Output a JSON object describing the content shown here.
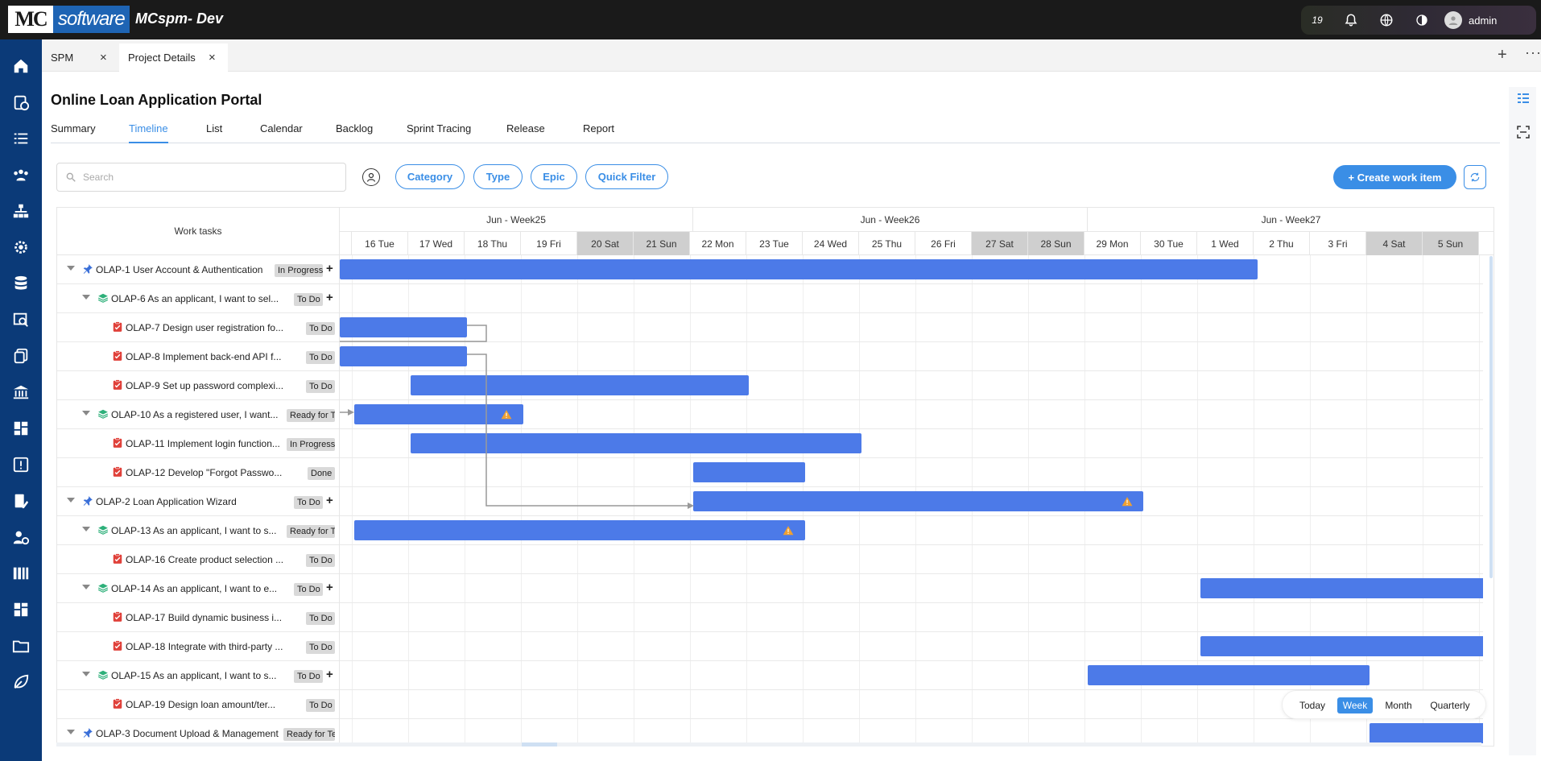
{
  "app": {
    "logo_mark": "MC",
    "logo_text": "software",
    "title": "MCspm- Dev",
    "notification_count": "19",
    "username": "admin"
  },
  "colors": {
    "accent": "#3a8ee6",
    "bar": "#4c7ae8",
    "sidebar": "#0b3a78",
    "topbar": "#1a1a1a"
  },
  "sidebar_icons": [
    "home-icon",
    "clipboard-clock-icon",
    "list-icon",
    "team-icon",
    "hierarchy-icon",
    "settings-icon",
    "database-icon",
    "search-doc-icon",
    "copy-icon",
    "bank-icon",
    "dashboard-icon",
    "alert-icon",
    "report-edit-icon",
    "user-clock-icon",
    "library-icon",
    "grid-icon",
    "folder-icon",
    "leaf-icon"
  ],
  "tabs": [
    {
      "label": "SPM"
    },
    {
      "label": "Project Details"
    }
  ],
  "project": {
    "title": "Online Loan Application Portal"
  },
  "nav_tabs": [
    "Summary",
    "Timeline",
    "List",
    "Calendar",
    "Backlog",
    "Sprint Tracing",
    "Release",
    "Report"
  ],
  "nav_active": "Timeline",
  "toolbar": {
    "search_placeholder": "Search",
    "filters": [
      "Category",
      "Type",
      "Epic",
      "Quick Filter"
    ],
    "create_label": "+ Create work item"
  },
  "gantt": {
    "left_header": "Work tasks",
    "weeks": [
      "Jun - Week25",
      "Jun - Week26",
      "Jun - Week27"
    ],
    "days": [
      "16 Tue",
      "17 Wed",
      "18 Thu",
      "19 Fri",
      "20 Sat",
      "21 Sun",
      "22 Mon",
      "23 Tue",
      "24 Wed",
      "25 Thu",
      "26 Fri",
      "27 Sat",
      "28 Sun",
      "29 Mon",
      "30 Tue",
      "1 Wed",
      "2 Thu",
      "3 Fri",
      "4 Sat",
      "5 Sun"
    ],
    "rows": [
      {
        "text": "OLAP-1 User Account & Authentication",
        "status": "In Progress",
        "type": "epic",
        "add": true
      },
      {
        "text": "OLAP-6 As an applicant, I want to sel...",
        "status": "To Do",
        "type": "story",
        "add": true
      },
      {
        "text": "OLAP-7 Design user registration fo...",
        "status": "To Do",
        "type": "task"
      },
      {
        "text": "OLAP-8 Implement back-end API f...",
        "status": "To Do",
        "type": "task"
      },
      {
        "text": "OLAP-9 Set up password complexi...",
        "status": "To Do",
        "type": "task"
      },
      {
        "text": "OLAP-10 As a registered user, I want...",
        "status": "Ready for T",
        "type": "story"
      },
      {
        "text": "OLAP-11 Implement login function...",
        "status": "In Progress",
        "type": "task"
      },
      {
        "text": "OLAP-12 Develop \"Forgot Passwo...",
        "status": "Done",
        "type": "task"
      },
      {
        "text": "OLAP-2 Loan Application Wizard",
        "status": "To Do",
        "type": "epic",
        "add": true
      },
      {
        "text": "OLAP-13 As an applicant, I want to s...",
        "status": "Ready for T",
        "type": "story"
      },
      {
        "text": "OLAP-16 Create product selection ...",
        "status": "To Do",
        "type": "task"
      },
      {
        "text": "OLAP-14 As an applicant, I want to e...",
        "status": "To Do",
        "type": "story",
        "add": true
      },
      {
        "text": "OLAP-17 Build dynamic business i...",
        "status": "To Do",
        "type": "task"
      },
      {
        "text": "OLAP-18 Integrate with third-party ...",
        "status": "To Do",
        "type": "task"
      },
      {
        "text": "OLAP-15 As an applicant, I want to s...",
        "status": "To Do",
        "type": "story",
        "add": true
      },
      {
        "text": "OLAP-19 Design loan amount/ter...",
        "status": "To Do",
        "type": "task"
      },
      {
        "text": "OLAP-3 Document Upload & Management",
        "status": "Ready for Te",
        "type": "epic"
      }
    ]
  },
  "zoom": {
    "options": [
      "Today",
      "Week",
      "Month",
      "Quarterly"
    ],
    "active": "Week"
  }
}
